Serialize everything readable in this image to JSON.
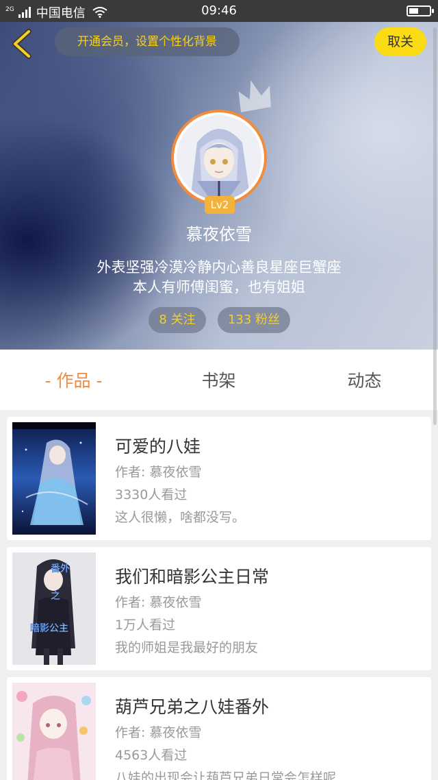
{
  "status_bar": {
    "network_type": "2G",
    "carrier": "中国电信",
    "time": "09:46",
    "battery_level": 0.45
  },
  "header": {
    "vip_banner": "开通会员，设置个性化背景",
    "unfollow_label": "取关",
    "level": "Lv2",
    "username": "慕夜依雪",
    "bio_line1": "外表坚强冷漠冷静内心善良星座巨蟹座",
    "bio_line2": "本人有师傅闺蜜，也有姐姐",
    "following": "8 关注",
    "fans": "133 粉丝"
  },
  "tabs": [
    {
      "label": "- 作品 -",
      "active": true
    },
    {
      "label": "书架",
      "active": false
    },
    {
      "label": "动态",
      "active": false
    }
  ],
  "works": [
    {
      "title": "可爱的八娃",
      "author": "作者: 慕夜依雪",
      "views": "3330人看过",
      "desc": "这人很懒，啥都没写。"
    },
    {
      "title": "我们和暗影公主日常",
      "author": "作者: 慕夜依雪",
      "views": "1万人看过",
      "desc": "我的师姐是我最好的朋友",
      "cover_text": [
        "番外",
        "之",
        "暗影公主"
      ]
    },
    {
      "title": "葫芦兄弟之八娃番外",
      "author": "作者: 慕夜依雪",
      "views": "4563人看过",
      "desc": "八娃的出现会让葫芦兄弟日常会怎样呢"
    }
  ],
  "colors": {
    "accent": "#f38b3c",
    "vip_text": "#f5d020",
    "unfollow_bg": "#fadb14"
  }
}
